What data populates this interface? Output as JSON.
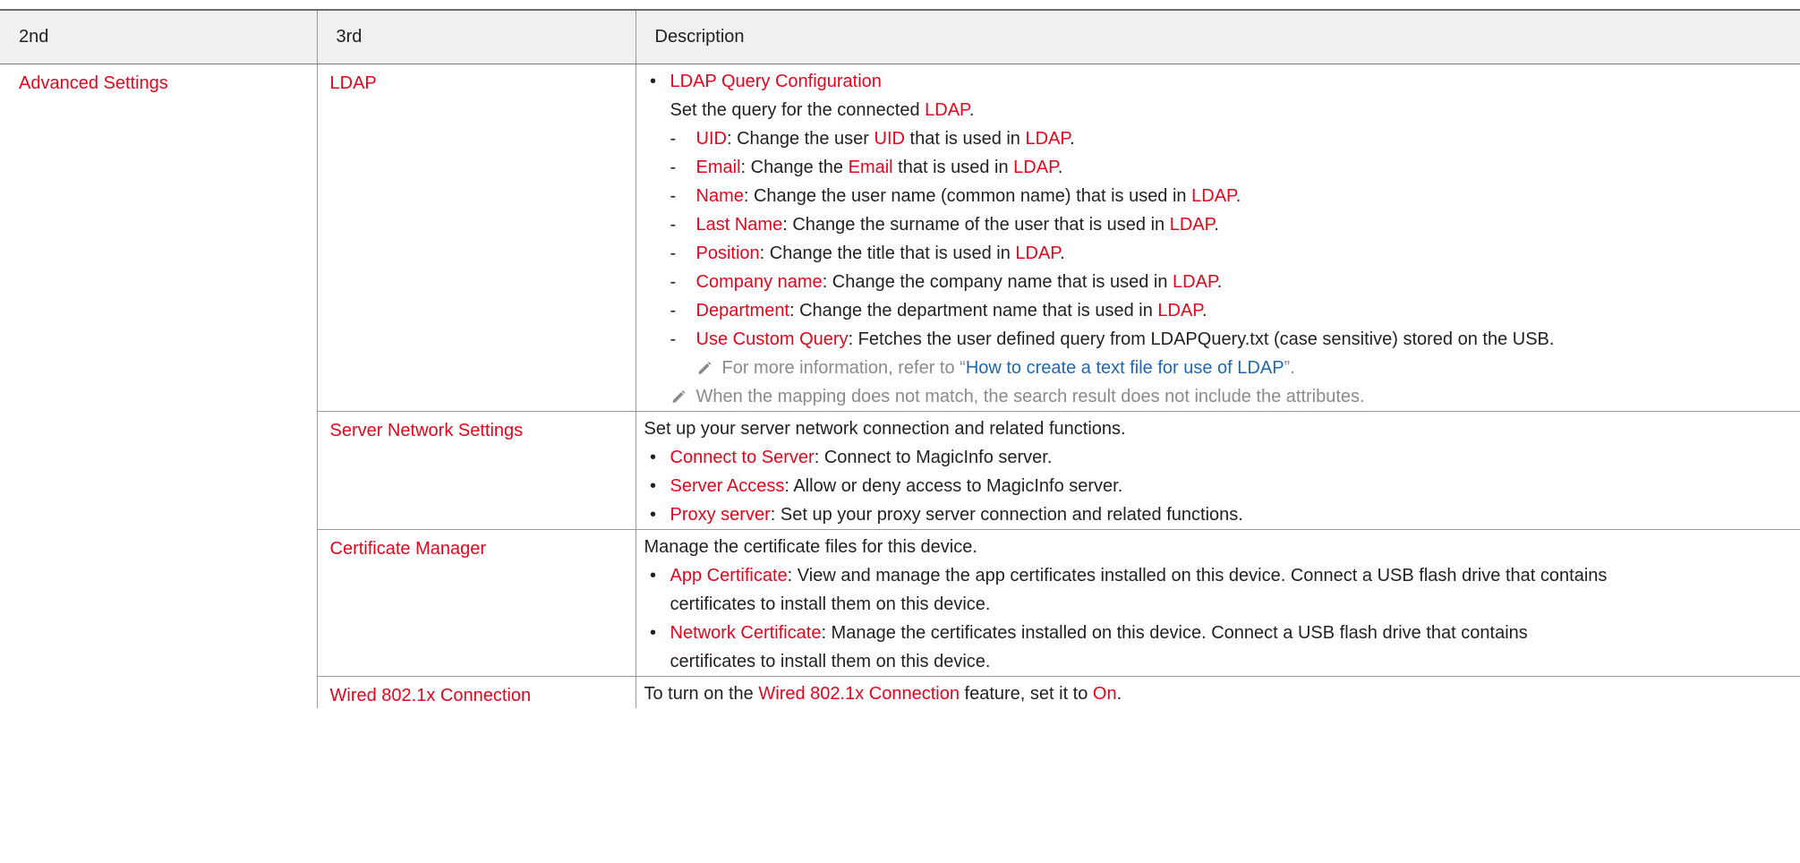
{
  "table": {
    "headers": {
      "second": "2nd",
      "third": "3rd",
      "description": "Description"
    },
    "second_level": "Advanced Settings",
    "ldap": {
      "label": "LDAP",
      "bullet_title": "LDAP Query Configuration",
      "intro_prefix": "Set the query for the connected ",
      "intro_term": "LDAP",
      "intro_suffix": ".",
      "items": [
        {
          "term": "UID",
          "text1": ": Change the user ",
          "term2": "UID",
          "text2": " that is used in ",
          "ldap": "LDAP",
          "end": "."
        },
        {
          "term": "Email",
          "text1": ": Change the ",
          "term2": "Email",
          "text2": " that is used in ",
          "ldap": "LDAP",
          "end": "."
        },
        {
          "term": "Name",
          "text2": ": Change the user name (common name) that is used in ",
          "ldap": "LDAP",
          "end": "."
        },
        {
          "term": "Last Name",
          "text2": ": Change the surname of the user that is used in ",
          "ldap": "LDAP",
          "end": "."
        },
        {
          "term": "Position",
          "text2": ": Change the title that is used in ",
          "ldap": "LDAP",
          "end": "."
        },
        {
          "term": "Company name",
          "text2": ": Change the company name that is used in ",
          "ldap": "LDAP",
          "end": "."
        },
        {
          "term": "Department",
          "text2": ": Change the department name that is used in ",
          "ldap": "LDAP",
          "end": "."
        }
      ],
      "custom_query": {
        "term": "Use Custom Query",
        "text": ": Fetches the user defined query from LDAPQuery.txt (case sensitive) stored on the USB."
      },
      "note_more": {
        "prefix": "For more information, refer to “",
        "link": "How to create a text file for use of LDAP",
        "suffix": "”."
      },
      "note_mapping": "When the mapping does not match, the search result does not include the attributes."
    },
    "server_network": {
      "label": "Server Network Settings",
      "intro": "Set up your server network connection and related functions.",
      "items": [
        {
          "term": "Connect to Server",
          "text": ": Connect to MagicInfo server."
        },
        {
          "term": "Server Access",
          "text": ": Allow or deny access to MagicInfo server."
        },
        {
          "term": "Proxy server",
          "text": ": Set up your proxy server connection and related functions."
        }
      ]
    },
    "certificate_manager": {
      "label": "Certificate Manager",
      "intro": "Manage the certificate files for this device.",
      "items": [
        {
          "term": "App Certificate",
          "text": ": View and manage the app certificates installed on this device. Connect a USB flash drive that contains",
          "text_cont": "certificates to install them on this device."
        },
        {
          "term": "Network Certificate",
          "text": ": Manage the certificates installed on this device. Connect a USB flash drive that contains",
          "text_cont": "certificates to install them on this device."
        }
      ]
    },
    "wired_8021x": {
      "label": "Wired 802.1x Connection",
      "prefix": "To turn on the ",
      "term": "Wired 802.1x Connection",
      "middle": " feature, set it to ",
      "value": "On",
      "end": "."
    }
  }
}
